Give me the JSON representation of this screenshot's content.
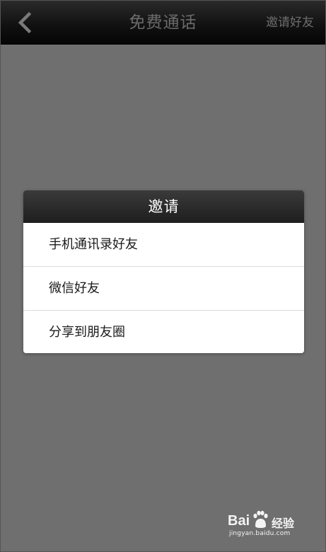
{
  "navbar": {
    "back_icon": "chevron-left-icon",
    "title": "免费通话",
    "action_label": "邀请好友"
  },
  "dialog": {
    "title": "邀请",
    "options": [
      {
        "label": "手机通讯录好友"
      },
      {
        "label": "微信好友"
      },
      {
        "label": "分享到朋友圈"
      }
    ]
  },
  "watermark": {
    "brand": "Bai",
    "brand_cn": "经验",
    "domain": "jingyan.baidu.com"
  },
  "colors": {
    "navbar_bg": "#101010",
    "overlay_bg": "#6f6f6f",
    "dialog_header_bg": "#2a2a2a",
    "dialog_bg": "#ffffff",
    "nav_text": "#6b6b6b"
  }
}
